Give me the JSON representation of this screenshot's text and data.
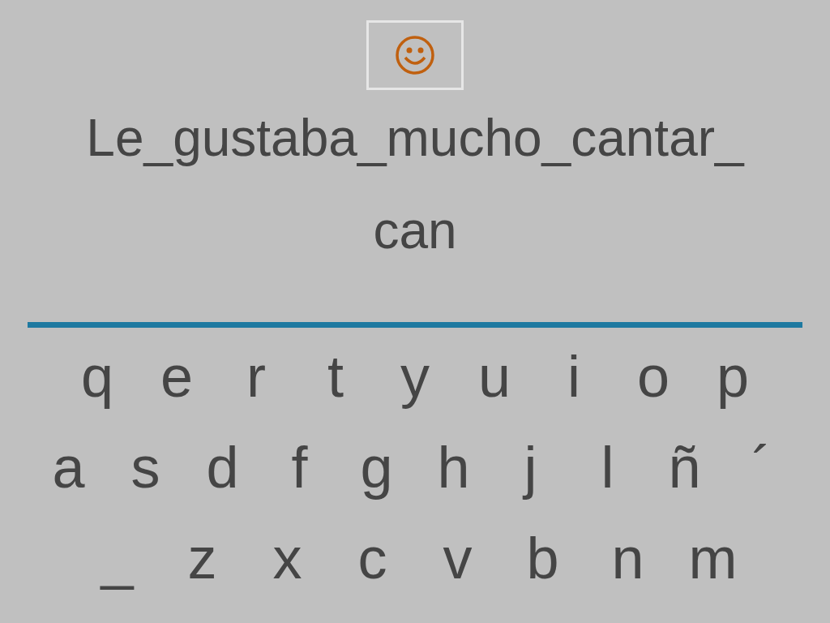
{
  "sentence": "Le_gustaba_mucho_cantar_",
  "answer": "can",
  "keyboard": [
    [
      "q",
      "e",
      "r",
      "t",
      "y",
      "u",
      "i",
      "o",
      "p"
    ],
    [
      "a",
      "s",
      "d",
      "f",
      "g",
      "h",
      "j",
      "l",
      "ñ",
      "´"
    ],
    [
      "_",
      "z",
      "x",
      "c",
      "v",
      "b",
      "n",
      "m"
    ]
  ]
}
